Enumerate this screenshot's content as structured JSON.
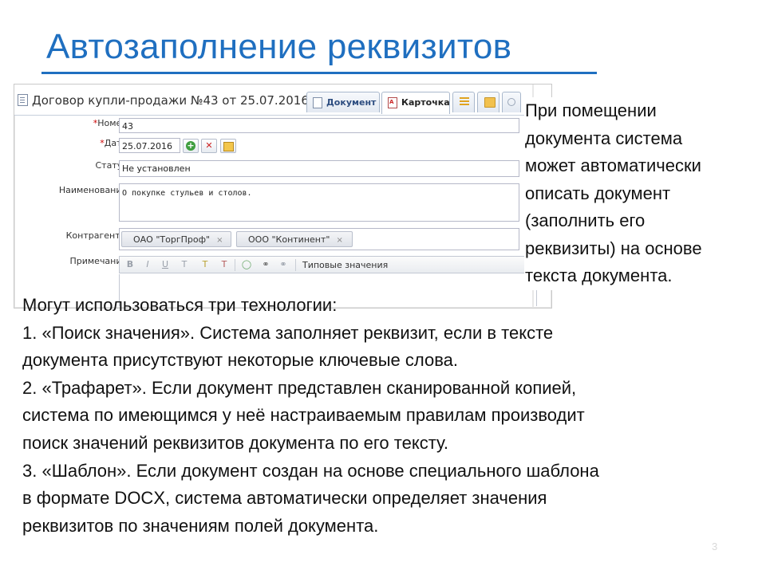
{
  "slide": {
    "title": "Автозаполнение реквизитов",
    "side_lines": [
      "При помещении",
      "документа система",
      "может автоматически",
      "описать документ",
      "(заполнить его",
      "реквизиты) на основе",
      "текста документа."
    ],
    "body_lines": [
      "Могут использоваться три технологии:",
      "1. «Поиск значения». Система заполняет реквизит, если в тексте",
      "документа присутствуют некоторые ключевые слова.",
      "2. «Трафарет». Если документ представлен сканированной копией,",
      "система по имеющимся у неё настраиваемым правилам производит",
      "поиск значений реквизитов документа по его тексту.",
      "3. «Шаблон». Если документ создан на основе специального шаблона",
      "в формате DOCX, система автоматически определяет значения",
      "реквизитов по значениям полей документа."
    ],
    "page_number": "3",
    "accent_color": "#1f6fc0"
  },
  "window": {
    "title": "Договор купли-продажи №43 от 25.07.2016",
    "tabs": [
      {
        "label": "Документ",
        "active": false
      },
      {
        "label": "Карточка",
        "active": true
      }
    ],
    "tab_icons": [
      "list-icon",
      "folder-icon",
      "more-icon"
    ],
    "form": {
      "number": {
        "required_mark": "*",
        "label": "Номер:",
        "value": "43"
      },
      "date": {
        "required_mark": "*",
        "label": "Дата:",
        "value": "25.07.2016"
      },
      "status": {
        "label": "Статус:",
        "value": "Не установлен"
      },
      "name": {
        "label": "Наименование:",
        "value": "О покупке стульев и столов."
      },
      "counterparties": {
        "label": "Контрагенты:",
        "items": [
          "ОАО \"ТоргПроф\"",
          "ООО \"Континент\""
        ],
        "remove_glyph": "×"
      },
      "note": {
        "label": "Примечание:",
        "toolbar_glyphs": [
          "B",
          "I",
          "U",
          "T",
          "T",
          "T",
          "◯",
          "⚭",
          "⚭"
        ],
        "typical_values": "Типовые значения"
      }
    }
  }
}
